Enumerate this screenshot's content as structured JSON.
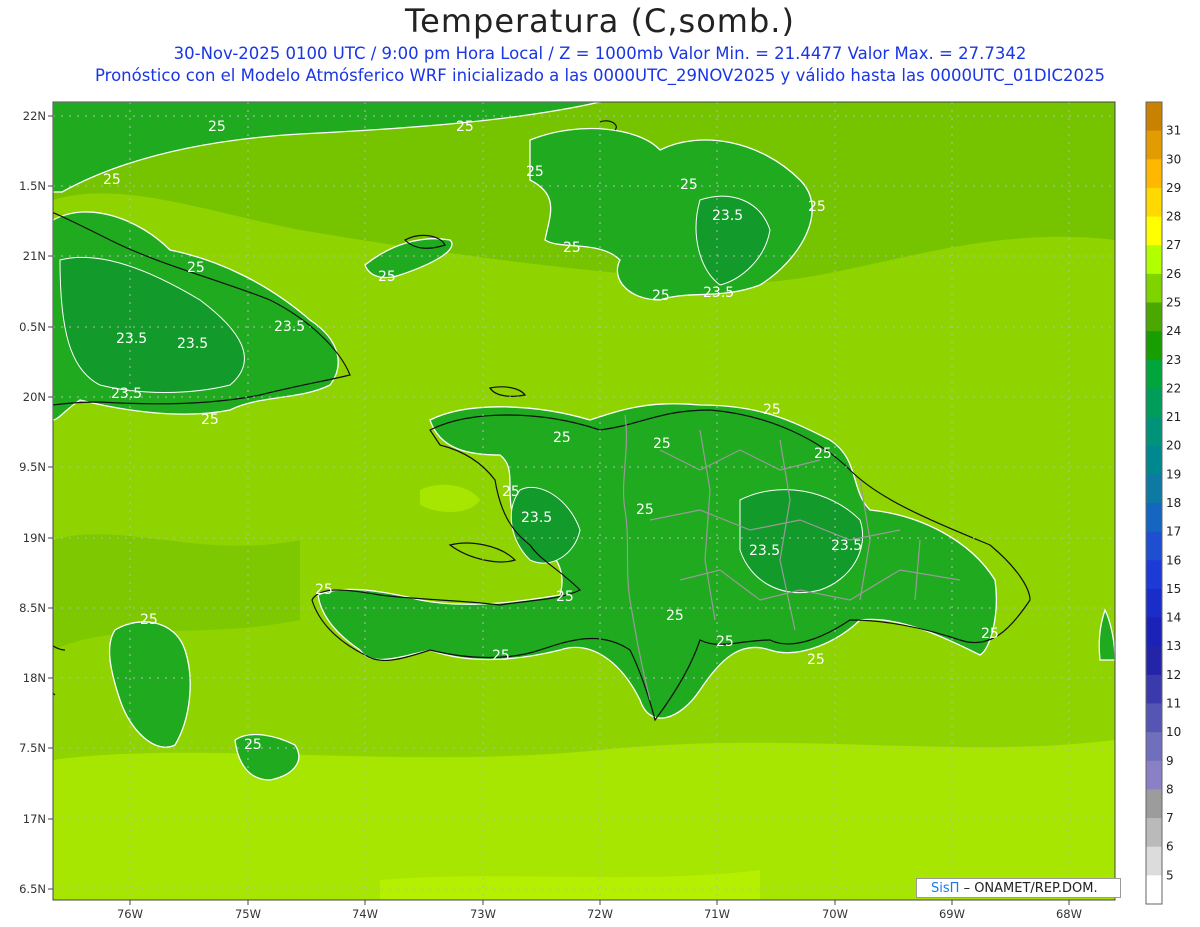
{
  "header": {
    "title": "Temperatura (C,somb.)",
    "subtitle1": "30-Nov-2025  0100 UTC / 9:00 pm Hora Local / Z = 1000mb   Valor Min. = 21.4477  Valor Max. = 27.7342",
    "subtitle2": "Pronóstico con el Modelo Atmósferico WRF inicializado a las 0000UTC_29NOV2025 y válido hasta las  0000UTC_01DIC2025"
  },
  "chart_data": {
    "type": "heatmap",
    "lon_range": [
      -76.6,
      -67.6
    ],
    "lat_range": [
      16.4,
      22.1
    ],
    "x_ticks": [
      "76W",
      "75W",
      "74W",
      "73W",
      "72W",
      "71W",
      "70W",
      "69W",
      "68W"
    ],
    "y_ticks": [
      "22N",
      "1.5N",
      "21N",
      "0.5N",
      "20N",
      "9.5N",
      "19N",
      "8.5N",
      "18N",
      "7.5N",
      "17N",
      "6.5N"
    ],
    "contour_labels": [
      "25",
      "23.5"
    ],
    "value_min": 21.4477,
    "value_max": 27.7342
  },
  "colorbar": {
    "levels": [
      "31",
      "30",
      "29",
      "28",
      "27",
      "26",
      "25",
      "24",
      "23",
      "22",
      "21",
      "20",
      "19",
      "18",
      "17",
      "16",
      "15",
      "14",
      "13",
      "12",
      "11",
      "10",
      "9",
      "8",
      "7",
      "6",
      "5"
    ],
    "colors": [
      "#c88200",
      "#e29b00",
      "#ffb700",
      "#ffd900",
      "#ffff00",
      "#b2ff00",
      "#7fd400",
      "#4aa800",
      "#189e00",
      "#00a53b",
      "#009c5a",
      "#00937a",
      "#00888f",
      "#0d7aa3",
      "#1466c0",
      "#1e4fd1",
      "#1c3bd6",
      "#1b2dc9",
      "#1b22b8",
      "#2424a8",
      "#3a3aac",
      "#5555b4",
      "#6f6fbe",
      "#8a80c5",
      "#9c9c9c",
      "#bababa",
      "#dcdcdc",
      "#ffffff"
    ]
  },
  "credit": {
    "logo": "SisΠ",
    "text": "– ONAMET/REP.DOM."
  }
}
